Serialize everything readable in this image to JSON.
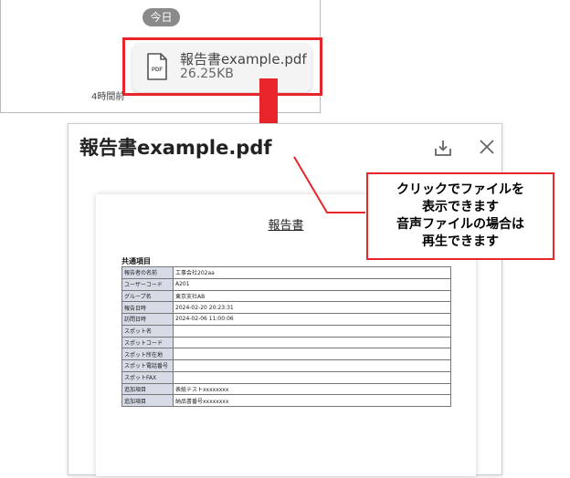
{
  "chat": {
    "date_label": "今日",
    "file": {
      "icon": "pdf-file-icon",
      "icon_text": "PDF",
      "name": "報告書example.pdf",
      "size": "26.25KB"
    },
    "time_ago": "4時間前"
  },
  "preview": {
    "title": "報告書example.pdf",
    "download_icon": "download-icon",
    "close_icon": "close-icon",
    "document": {
      "title": "報告書",
      "section": "共通項目",
      "rows": [
        {
          "label": "報告者の名前",
          "value": "工事会社202aa"
        },
        {
          "label": "ユーザーコード",
          "value": "A201"
        },
        {
          "label": "グループ名",
          "value": "東京支社AB"
        },
        {
          "label": "報告日時",
          "value": "2024-02-20 20:23:31"
        },
        {
          "label": "訪問日時",
          "value": "2024-02-06 11:00:06"
        },
        {
          "label": "スポット名",
          "value": ""
        },
        {
          "label": "スポットコード",
          "value": ""
        },
        {
          "label": "スポット所在地",
          "value": ""
        },
        {
          "label": "スポット電話番号",
          "value": ""
        },
        {
          "label": "スポットFAX",
          "value": ""
        },
        {
          "label": "追加項目",
          "value": "表紙テストxxxxxxxx"
        },
        {
          "label": "追加項目",
          "value": "納品書番号xxxxxxxx"
        }
      ]
    }
  },
  "callout": {
    "lines": [
      "クリックでファイルを",
      "表示できます",
      "音声ファイルの場合は",
      "再生できます"
    ]
  },
  "colors": {
    "highlight": "#e8252b",
    "chip": "#8a8a8a",
    "table_label_bg": "#d6dbe6"
  }
}
